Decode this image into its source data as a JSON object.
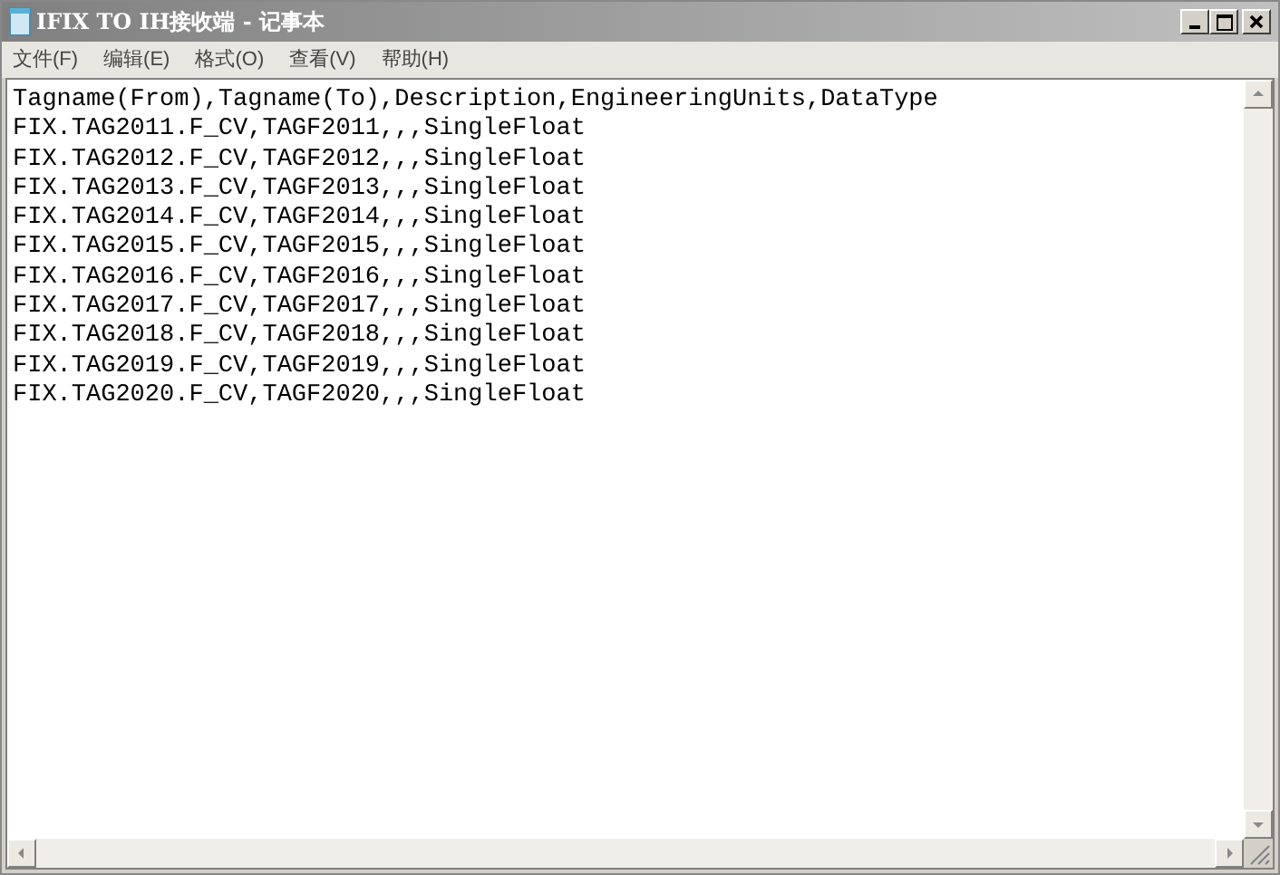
{
  "window": {
    "title": "IFIX TO IH接收端 - 记事本"
  },
  "menu": [
    {
      "label": "文件(F)"
    },
    {
      "label": "编辑(E)"
    },
    {
      "label": "格式(O)"
    },
    {
      "label": "查看(V)"
    },
    {
      "label": "帮助(H)"
    }
  ],
  "editor": {
    "lines": [
      "Tagname(From),Tagname(To),Description,EngineeringUnits,DataType",
      "FIX.TAG2011.F_CV,TAGF2011,,,SingleFloat",
      "FIX.TAG2012.F_CV,TAGF2012,,,SingleFloat",
      "FIX.TAG2013.F_CV,TAGF2013,,,SingleFloat",
      "FIX.TAG2014.F_CV,TAGF2014,,,SingleFloat",
      "FIX.TAG2015.F_CV,TAGF2015,,,SingleFloat",
      "FIX.TAG2016.F_CV,TAGF2016,,,SingleFloat",
      "FIX.TAG2017.F_CV,TAGF2017,,,SingleFloat",
      "FIX.TAG2018.F_CV,TAGF2018,,,SingleFloat",
      "FIX.TAG2019.F_CV,TAGF2019,,,SingleFloat",
      "FIX.TAG2020.F_CV,TAGF2020,,,SingleFloat"
    ]
  }
}
